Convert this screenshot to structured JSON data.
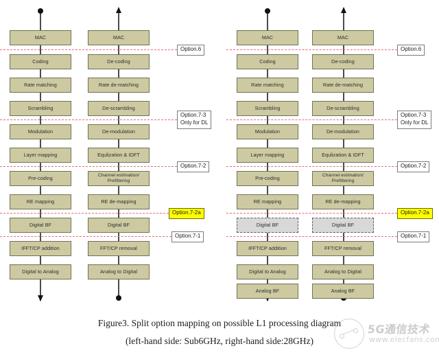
{
  "figure": {
    "caption_line1": "Figure3. Split option mapping on possible L1 processing diagram",
    "caption_line2": "(left-hand side: Sub6GHz, right-hand side:28GHz)"
  },
  "watermark": {
    "text_cn": "5G通信技术",
    "text_url": "www.elecfans.com"
  },
  "colors": {
    "box_fill": "#cdcaa2",
    "box_border": "#6f7155",
    "ghost_fill": "#d8d8d8",
    "ghost_border": "#5c5c5c",
    "split_line": "#e8697a",
    "highlight": "#ffff00",
    "connector": "#4b4b4b"
  },
  "diagrams": [
    {
      "id": "sub6ghz",
      "name": "left-hand side: Sub6GHz",
      "columns": [
        {
          "id": "sub6-tx",
          "direction": "downlink-transmit",
          "top_terminator": "dot",
          "bottom_terminator": "arrow-down",
          "blocks": [
            {
              "label": "MAC",
              "style": "solid"
            },
            {
              "label": "Coding",
              "style": "solid"
            },
            {
              "label": "Rate matching",
              "style": "solid"
            },
            {
              "label": "Scrambling",
              "style": "solid"
            },
            {
              "label": "Modulation",
              "style": "solid"
            },
            {
              "label": "Layer mapping",
              "style": "solid"
            },
            {
              "label": "Pre-coding",
              "style": "solid"
            },
            {
              "label": "RE mapping",
              "style": "solid"
            },
            {
              "label": "Digital BF",
              "style": "solid"
            },
            {
              "label": "IFFT/CP addition",
              "style": "solid"
            },
            {
              "label": "Digital to Analog",
              "style": "solid"
            }
          ]
        },
        {
          "id": "sub6-rx",
          "direction": "uplink-receive",
          "top_terminator": "arrow-up",
          "bottom_terminator": "dot",
          "blocks": [
            {
              "label": "MAC",
              "style": "solid"
            },
            {
              "label": "De-coding",
              "style": "solid"
            },
            {
              "label": "Rate de-matching",
              "style": "solid"
            },
            {
              "label": "De-scrambling",
              "style": "solid"
            },
            {
              "label": "De-modulation",
              "style": "solid"
            },
            {
              "label": "Equlization & IDFT",
              "style": "solid"
            },
            {
              "label": "Channel estimation/\nPrefiltering",
              "style": "solid"
            },
            {
              "label": "RE de-mapping",
              "style": "solid"
            },
            {
              "label": "Digital BF",
              "style": "solid"
            },
            {
              "label": "FFT/CP removal",
              "style": "solid"
            },
            {
              "label": "Analog to Digital",
              "style": "solid"
            }
          ]
        }
      ],
      "split_options": [
        {
          "label": "Option.6",
          "highlight": false
        },
        {
          "label": "Option.7-3\nOnly for DL",
          "highlight": false
        },
        {
          "label": "Option.7-2",
          "highlight": false
        },
        {
          "label": "Option.7-2a",
          "highlight": true
        },
        {
          "label": "Option.7-1",
          "highlight": false
        }
      ]
    },
    {
      "id": "28ghz",
      "name": "right-hand side: 28GHz",
      "columns": [
        {
          "id": "28-tx",
          "direction": "downlink-transmit",
          "top_terminator": "dot",
          "bottom_terminator": "arrow-down",
          "blocks": [
            {
              "label": "MAC",
              "style": "solid"
            },
            {
              "label": "Coding",
              "style": "solid"
            },
            {
              "label": "Rate matching",
              "style": "solid"
            },
            {
              "label": "Scrambling",
              "style": "solid"
            },
            {
              "label": "Modulation",
              "style": "solid"
            },
            {
              "label": "Layer mapping",
              "style": "solid"
            },
            {
              "label": "Pre-coding",
              "style": "solid"
            },
            {
              "label": "RE mapping",
              "style": "solid"
            },
            {
              "label": "Digital BF",
              "style": "dashed"
            },
            {
              "label": "IFFT/CP addition",
              "style": "solid"
            },
            {
              "label": "Digital to Analog",
              "style": "solid"
            },
            {
              "label": "Analog BF",
              "style": "solid"
            }
          ]
        },
        {
          "id": "28-rx",
          "direction": "uplink-receive",
          "top_terminator": "arrow-up",
          "bottom_terminator": "dot",
          "blocks": [
            {
              "label": "MAC",
              "style": "solid"
            },
            {
              "label": "De-coding",
              "style": "solid"
            },
            {
              "label": "Rate de-matching",
              "style": "solid"
            },
            {
              "label": "De-scrambling",
              "style": "solid"
            },
            {
              "label": "De-modulation",
              "style": "solid"
            },
            {
              "label": "Equlization & IDFT",
              "style": "solid"
            },
            {
              "label": "Channel estimation/\nPrefiltering",
              "style": "solid"
            },
            {
              "label": "RE de-mapping",
              "style": "solid"
            },
            {
              "label": "Digital BF",
              "style": "dashed"
            },
            {
              "label": "FFT/CP removal",
              "style": "solid"
            },
            {
              "label": "Analog to Digital",
              "style": "solid"
            },
            {
              "label": "Analog BF",
              "style": "solid"
            }
          ]
        }
      ],
      "split_options": [
        {
          "label": "Option.6",
          "highlight": false
        },
        {
          "label": "Option.7-3\nOnly for DL",
          "highlight": false
        },
        {
          "label": "Option.7-2",
          "highlight": false
        },
        {
          "label": "Option.7-2a",
          "highlight": true
        },
        {
          "label": "Option.7-1",
          "highlight": false
        }
      ]
    }
  ]
}
